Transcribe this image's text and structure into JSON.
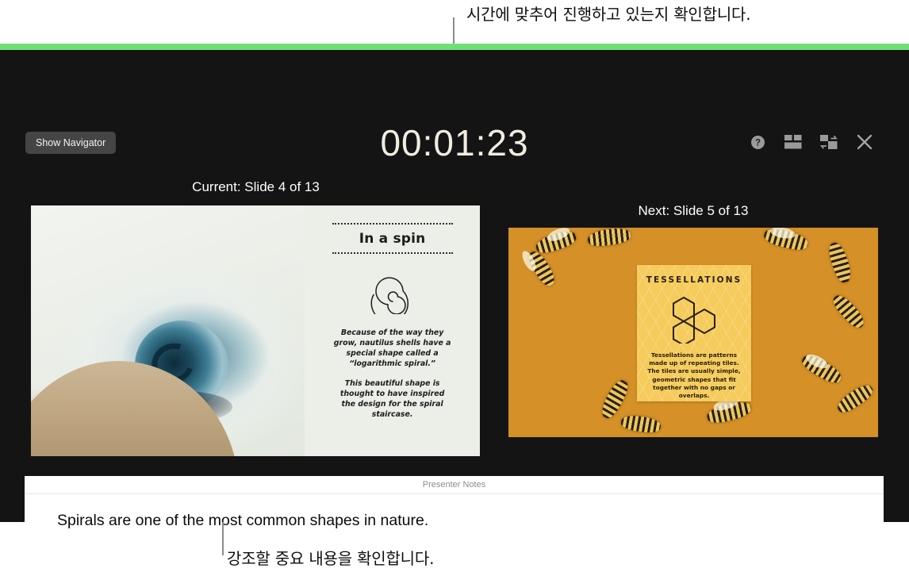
{
  "annotations": {
    "top": "시간에 맞추어 진행하고 있는지 확인합니다.",
    "bottom": "강조할 중요 내용을 확인합니다."
  },
  "colors": {
    "accent_green": "#6fe077",
    "stage_background": "#141414",
    "timer_text": "#f1ece0",
    "button_background": "#454545",
    "notes_background": "#ffffff",
    "tessellation_card": "#f5cb5c"
  },
  "toolbar": {
    "show_navigator_label": "Show Navigator",
    "timer": "00:01:23",
    "icons": [
      {
        "name": "help-icon",
        "glyph": "?"
      },
      {
        "name": "layout-icon",
        "glyph": "▤"
      },
      {
        "name": "swap-displays-icon",
        "glyph": "⇄"
      },
      {
        "name": "close-icon",
        "glyph": "✕"
      }
    ]
  },
  "slides": {
    "current": {
      "label": "Current: Slide 4 of 13",
      "number": 4,
      "total": 13,
      "title": "In a spin",
      "image": "nautilus-shell-photo",
      "graphic": "spiral-icon",
      "paragraphs": [
        "Because of the way they grow, nautilus shells have a special shape called a “logarithmic spiral.”",
        "This beautiful shape is thought to have inspired the design for the spiral staircase."
      ]
    },
    "next": {
      "label": "Next: Slide 5 of 13",
      "number": 5,
      "total": 13,
      "title": "TESSELLATIONS",
      "image": "honeycomb-bees-photo",
      "graphic": "hexagons-icon",
      "body": "Tessellations are patterns made up of repeating tiles. The tiles are usually simple, geometric shapes that fit together with no gaps or overlaps."
    }
  },
  "notes": {
    "header": "Presenter Notes",
    "text": "Spirals are one of the most common shapes in nature."
  }
}
